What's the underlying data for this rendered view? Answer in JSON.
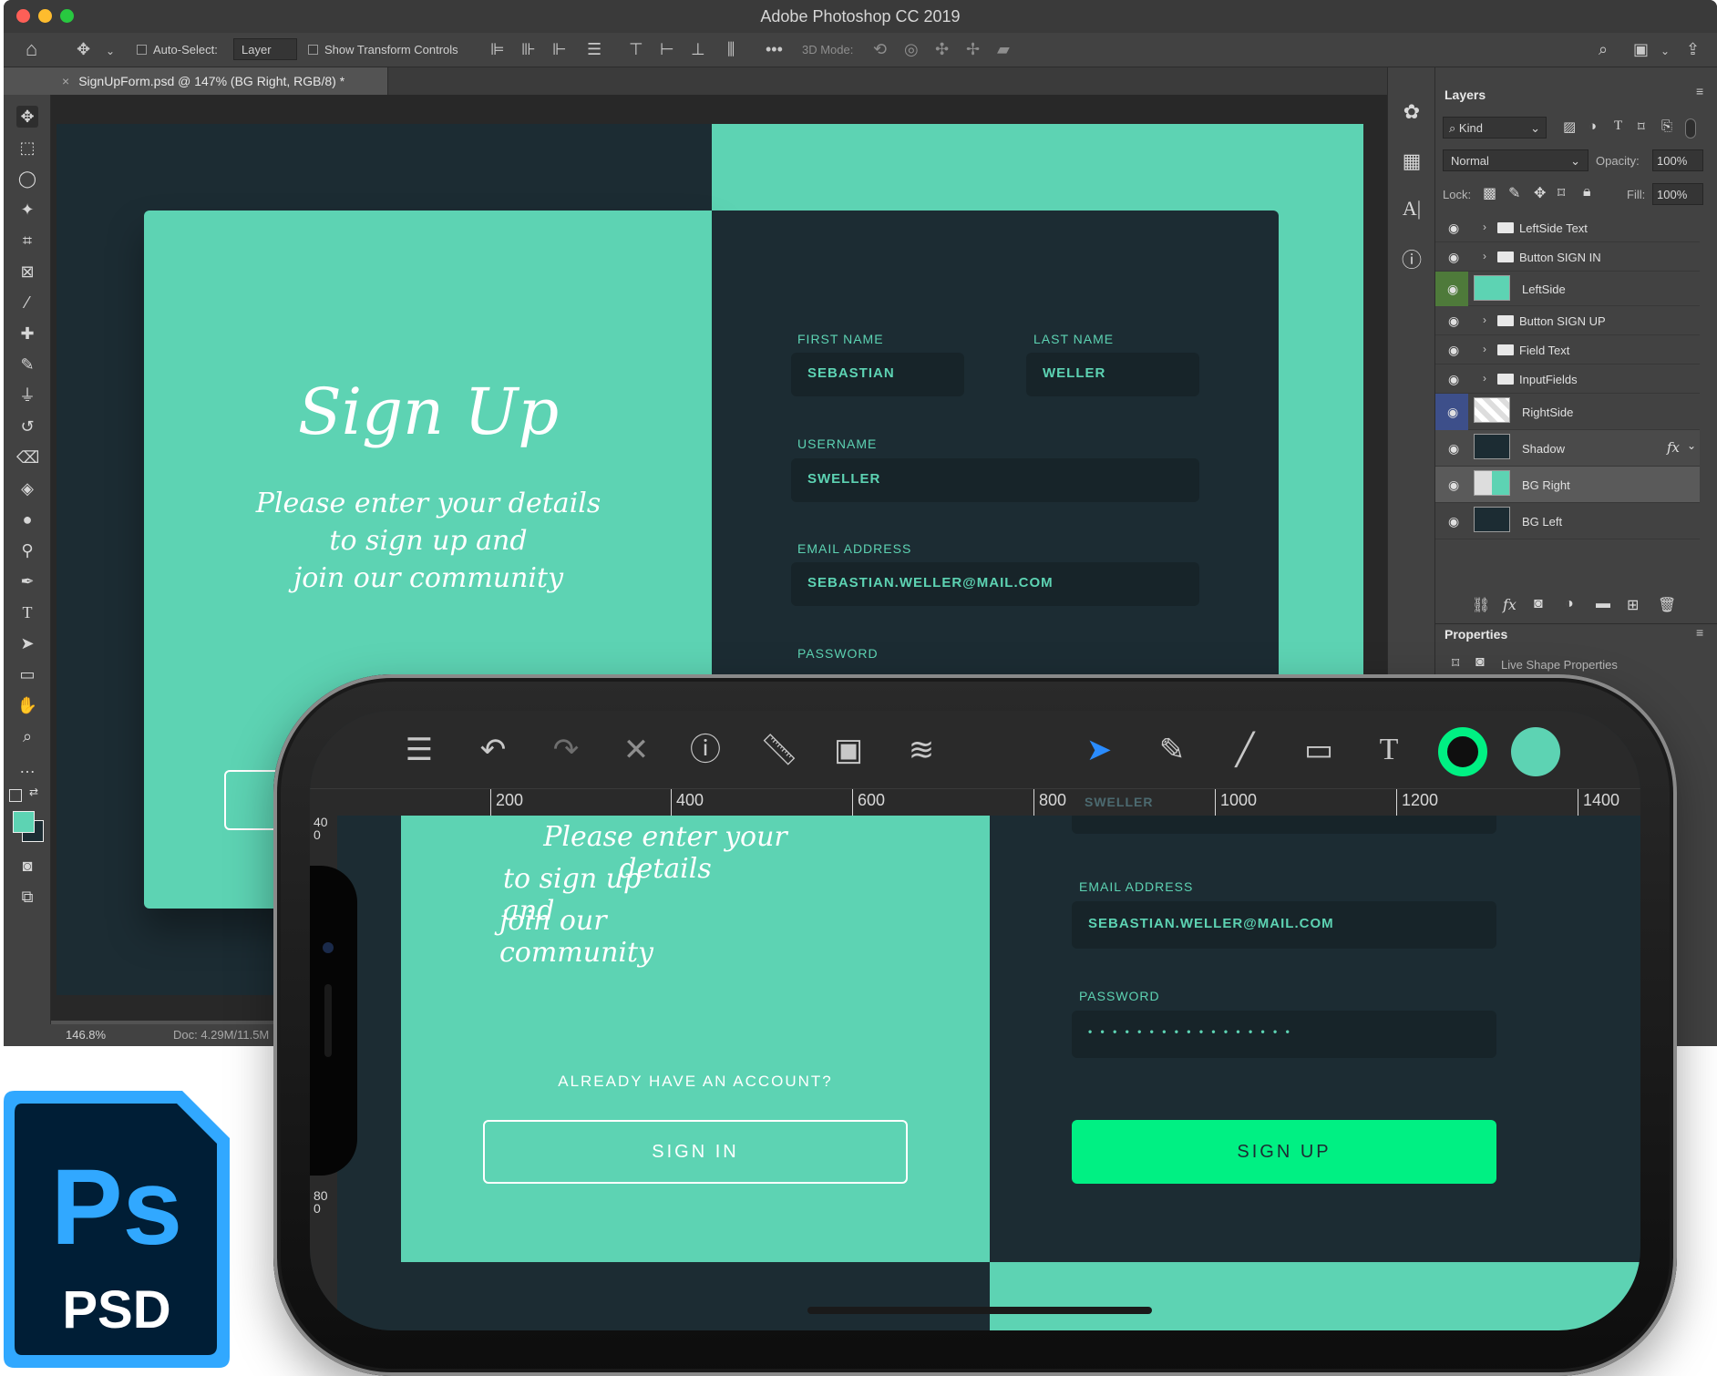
{
  "window": {
    "title": "Adobe Photoshop CC 2019",
    "doc_tab": "SignUpForm.psd @ 147% (BG Right, RGB/8) *"
  },
  "options_bar": {
    "auto_select_label": "Auto-Select:",
    "auto_select_value": "Layer",
    "show_transform_label": "Show Transform Controls",
    "three_d_mode_label": "3D Mode:"
  },
  "status_bar": {
    "zoom": "146.8%",
    "doc_info": "Doc: 4.29M/11.5M"
  },
  "design": {
    "heading": "Sign Up",
    "tagline_1": "Please enter your details",
    "tagline_2": "to sign up and",
    "tagline_3": "join our community",
    "first_name_label": "FIRST NAME",
    "first_name_value": "SEBASTIAN",
    "last_name_label": "LAST NAME",
    "last_name_value": "WELLER",
    "username_label": "USERNAME",
    "username_value": "SWELLER",
    "email_label": "EMAIL ADDRESS",
    "email_value": "SEBASTIAN.WELLER@MAIL.COM",
    "password_label": "PASSWORD",
    "password_value": "• • • • • • • • • • • • • • • • •",
    "already_label": "ALREADY HAVE AN ACCOUNT?",
    "sign_in_label": "SIGN IN",
    "sign_up_label": "SIGN UP",
    "faded_username": "SWELLER"
  },
  "layers_panel": {
    "tab_label": "Layers",
    "kind_label": "Kind",
    "blend_mode": "Normal",
    "opacity_label": "Opacity:",
    "opacity_value": "100%",
    "lock_label": "Lock:",
    "fill_label": "Fill:",
    "fill_value": "100%",
    "layers": [
      {
        "name": "LeftSide Text"
      },
      {
        "name": "Button SIGN IN"
      },
      {
        "name": "LeftSide"
      },
      {
        "name": "Button SIGN UP"
      },
      {
        "name": "Field Text"
      },
      {
        "name": "InputFields"
      },
      {
        "name": "RightSide"
      },
      {
        "name": "Shadow",
        "fx": "fx"
      },
      {
        "name": "BG Right"
      },
      {
        "name": "BG Left"
      }
    ]
  },
  "properties_panel": {
    "tab_label": "Properties",
    "subtitle": "Live Shape Properties"
  },
  "ruler": {
    "labels": [
      "200",
      "400",
      "600",
      "800",
      "1000",
      "1200",
      "1400"
    ],
    "v_labels": [
      "400",
      "800"
    ]
  },
  "logo": {
    "mark": "Ps",
    "caption": "PSD"
  },
  "colors": {
    "teal": "#5dd3b3",
    "dark": "#1c2c33",
    "signup_green": "#00f083",
    "ps_blue": "#31a8ff",
    "ps_dark": "#001e36"
  }
}
